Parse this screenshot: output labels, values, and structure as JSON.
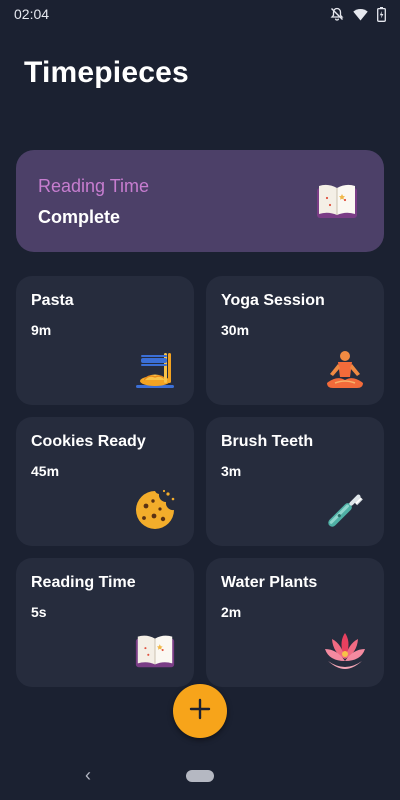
{
  "status_bar": {
    "time": "02:04",
    "icons": [
      "bell-off-icon",
      "wifi-icon",
      "battery-icon"
    ]
  },
  "page": {
    "title": "Timepieces"
  },
  "banner": {
    "title": "Reading Time",
    "status": "Complete",
    "icon": "book-icon",
    "colors": {
      "background": "#4c4068",
      "title": "#c77dd0"
    }
  },
  "timers": [
    {
      "name": "Pasta",
      "time": "9m",
      "icon": "pasta-icon"
    },
    {
      "name": "Yoga Session",
      "time": "30m",
      "icon": "yoga-icon"
    },
    {
      "name": "Cookies Ready",
      "time": "45m",
      "icon": "cookie-icon"
    },
    {
      "name": "Brush Teeth",
      "time": "3m",
      "icon": "toothbrush-icon"
    },
    {
      "name": "Reading Time",
      "time": "5s",
      "icon": "book-icon"
    },
    {
      "name": "Water Plants",
      "time": "2m",
      "icon": "lotus-icon"
    }
  ],
  "fab": {
    "icon": "plus-icon",
    "color": "#f7a41a"
  },
  "nav": {
    "back_glyph": "‹"
  },
  "colors": {
    "background": "#1b2131",
    "tile": "#262c3d"
  }
}
